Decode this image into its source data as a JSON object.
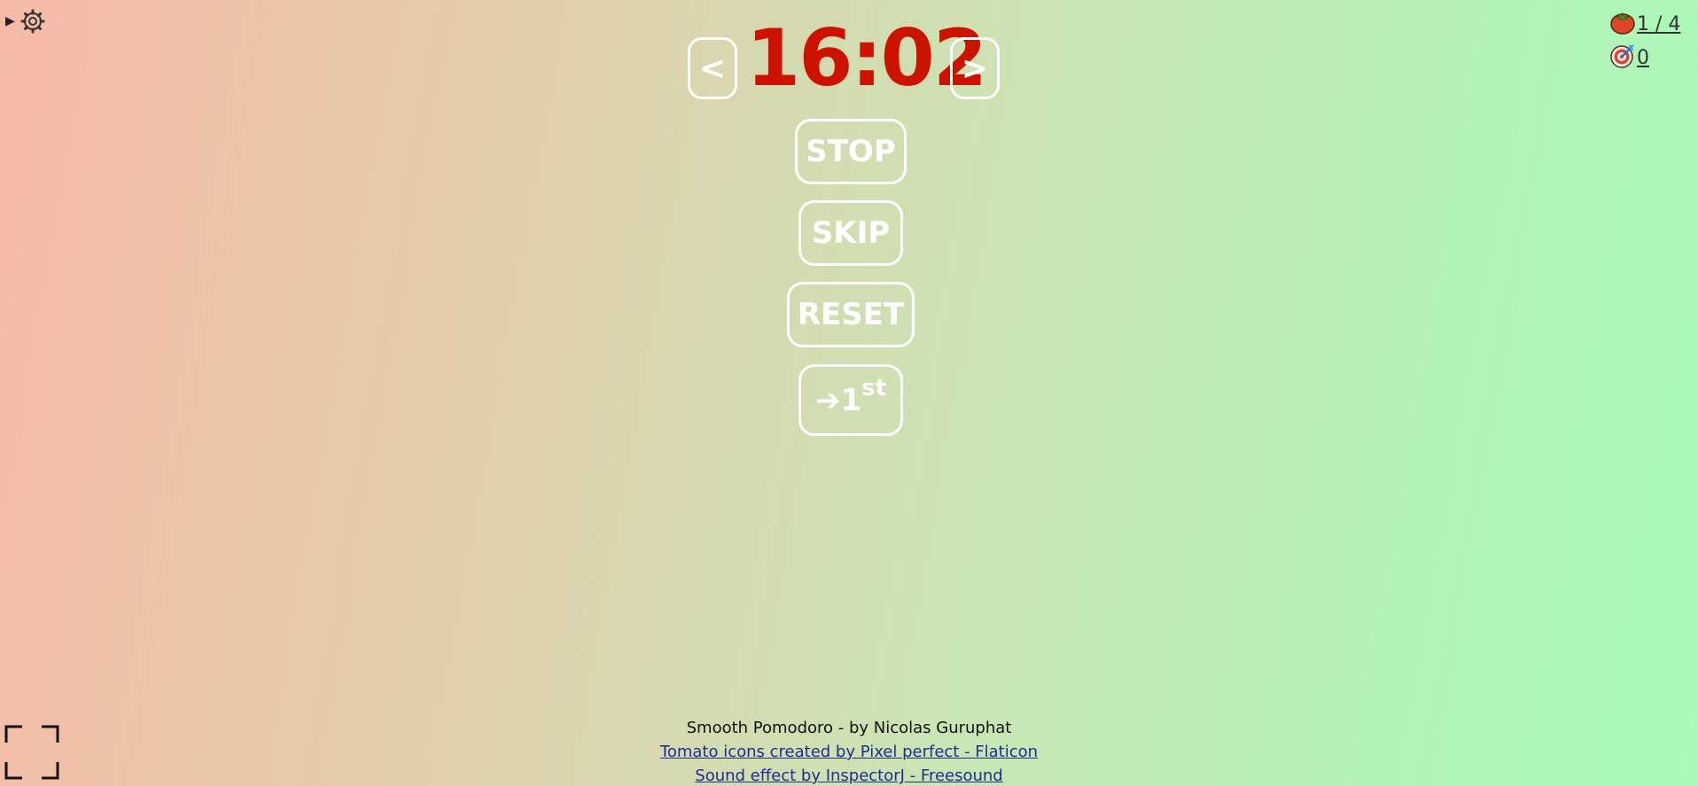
{
  "settings": {
    "toggle_icon": "triangle-right-icon",
    "gear_icon": "gear-icon",
    "toggle_glyph": "▶"
  },
  "stats": {
    "pomodoro_icon": "tomato-icon",
    "pomodoro_count": "1 / 4",
    "goal_icon": "target-icon",
    "goal_count": "0"
  },
  "timer": {
    "prev_label": "<",
    "time": "16:02",
    "next_label": ">",
    "color": "#cc1300"
  },
  "controls": {
    "stop_label": "STOP",
    "skip_label": "SKIP",
    "reset_label": "RESET",
    "first_arrow": "➔1",
    "first_sup": "st"
  },
  "fullscreen": {
    "icon": "fullscreen-icon"
  },
  "footer": {
    "credit": "Smooth Pomodoro - by Nicolas Guruphat",
    "icons_link": "Tomato icons created by Pixel perfect - Flaticon",
    "sound_link": "Sound effect by InspectorJ - Freesound"
  }
}
